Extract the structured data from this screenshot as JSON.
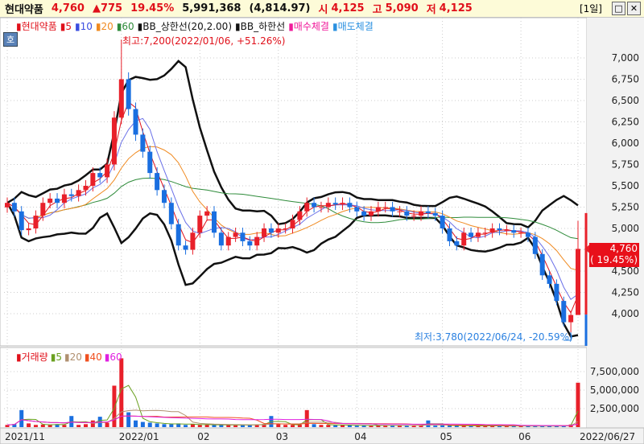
{
  "header": {
    "name": "현대약품",
    "price": "4,760",
    "change": "▲775",
    "change_pct": "19.45%",
    "volume": "5,991,368",
    "avg_price": "(4,814.97)",
    "open_label": "시",
    "open": "4,125",
    "high_label": "고",
    "high": "5,090",
    "low_label": "저",
    "low": "4,125",
    "period": "[1일]",
    "maximize_icon": "window-maximize-icon",
    "close_icon": "close-icon"
  },
  "hoga_button": "호",
  "legend": {
    "items": [
      {
        "label": "현대약품",
        "color": "#e0101a"
      },
      {
        "label": "5",
        "color": "#e0101a"
      },
      {
        "label": "10",
        "color": "#3a4de0"
      },
      {
        "label": "20",
        "color": "#f08a20"
      },
      {
        "label": "60",
        "color": "#2e8b3a"
      },
      {
        "label": "BB_상한선(20,2.00)",
        "color": "#111111"
      },
      {
        "label": "BB_하한선",
        "color": "#111111"
      },
      {
        "label": "매수체결",
        "color": "#f0199a"
      },
      {
        "label": "매도체결",
        "color": "#2a90e0"
      }
    ]
  },
  "volume_legend": {
    "items": [
      {
        "label": "거래량",
        "color": "#e0101a"
      },
      {
        "label": "5",
        "color": "#6aa020"
      },
      {
        "label": "20",
        "color": "#b09070"
      },
      {
        "label": "40",
        "color": "#f05020"
      },
      {
        "label": "60",
        "color": "#e020e0"
      }
    ]
  },
  "annotations": {
    "max": "최고:7,200(2022/01/06, +51.26%)",
    "min": "최저:3,780(2022/06/24, -20.59%)"
  },
  "current_label": {
    "price": "4,760",
    "pct": "( 19.45%)"
  },
  "colors": {
    "up": "#e8202a",
    "down": "#1a6fe0"
  },
  "chart_data": {
    "type": "candlestick",
    "price_axis": {
      "ticks": [
        4000,
        4250,
        4500,
        4750,
        5000,
        5250,
        5500,
        5750,
        6000,
        6250,
        6500,
        6750,
        7000
      ],
      "tick_labels": [
        "4,000",
        "4,250",
        "4,500",
        "4,750",
        "5,000",
        "5,250",
        "5,500",
        "5,750",
        "6,000",
        "6,250",
        "6,500",
        "6,750",
        "7,000"
      ],
      "ylim": [
        3720,
        7500
      ]
    },
    "volume_axis": {
      "ticks": [
        2500000,
        5000000,
        7500000
      ],
      "tick_labels": [
        "2,500,000",
        "5,000,000",
        "7,500,000"
      ]
    },
    "x_tick_labels": [
      "2021/11",
      "2022/01",
      "02",
      "03",
      "04",
      "05",
      "06",
      "2022/06/27"
    ],
    "x_tick_index": [
      0,
      16,
      27,
      38,
      49,
      61,
      72,
      80
    ],
    "close": [
      5300,
      5200,
      4980,
      5000,
      5150,
      5300,
      5350,
      5300,
      5400,
      5380,
      5450,
      5500,
      5650,
      5600,
      5750,
      6300,
      6750,
      6400,
      6100,
      5900,
      5650,
      5450,
      5300,
      5050,
      4800,
      4750,
      4950,
      5150,
      5200,
      4950,
      4800,
      4900,
      4950,
      4850,
      4800,
      4900,
      5000,
      4950,
      5000,
      5000,
      5100,
      5200,
      5300,
      5250,
      5250,
      5300,
      5280,
      5300,
      5250,
      5200,
      5150,
      5200,
      5250,
      5250,
      5200,
      5200,
      5150,
      5150,
      5200,
      5180,
      5150,
      5000,
      4850,
      4800,
      4950,
      4900,
      4950,
      4950,
      5000,
      4980,
      4980,
      4950,
      4950,
      4900,
      4700,
      4450,
      4350,
      4150,
      3900,
      3985,
      4760
    ],
    "volume": [
      300000,
      400000,
      2300000,
      500000,
      300000,
      350000,
      300000,
      400000,
      300000,
      1500000,
      300000,
      400000,
      900000,
      1400000,
      600000,
      5600000,
      9300000,
      2000000,
      900000,
      700000,
      600000,
      500000,
      400000,
      400000,
      500000,
      300000,
      400000,
      300000,
      350000,
      300000,
      300000,
      300000,
      250000,
      300000,
      300000,
      350000,
      400000,
      1500000,
      400000,
      300000,
      300000,
      350000,
      2300000,
      400000,
      300000,
      300000,
      250000,
      300000,
      250000,
      200000,
      250000,
      200000,
      250000,
      200000,
      200000,
      250000,
      200000,
      200000,
      250000,
      900000,
      200000,
      250000,
      200000,
      200000,
      200000,
      150000,
      150000,
      200000,
      150000,
      150000,
      150000,
      150000,
      150000,
      150000,
      150000,
      150000,
      150000,
      150000,
      200000,
      350000,
      6000000
    ],
    "max": {
      "value": 7200,
      "date": "2022/01/06",
      "pct": "+51.26%"
    },
    "min": {
      "value": 3780,
      "date": "2022/06/24",
      "pct": "-20.59%"
    },
    "grid": true
  }
}
